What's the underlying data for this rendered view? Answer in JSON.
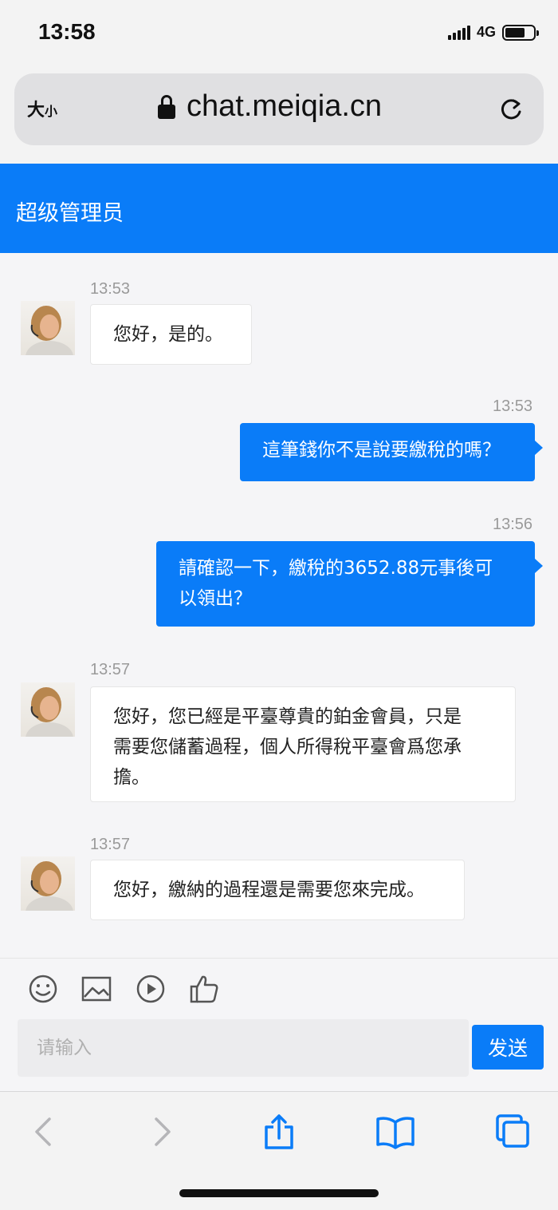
{
  "status_bar": {
    "time": "13:58",
    "network": "4G"
  },
  "browser": {
    "text_size_label": "大",
    "text_size_small": "小",
    "url": "chat.meiqia.cn",
    "icons": [
      "lock-icon",
      "reload-icon"
    ]
  },
  "chat": {
    "title": "超级管理员",
    "messages": [
      {
        "from": "agent",
        "time": "13:53",
        "text": "您好，是的。"
      },
      {
        "from": "user",
        "time": "13:53",
        "text": "這筆錢你不是說要繳稅的嗎？"
      },
      {
        "from": "user",
        "time": "13:56",
        "line1": "請確認一下，繳稅的3652.88元事後可",
        "line2": "以領出？"
      },
      {
        "from": "agent",
        "time": "13:57",
        "line1": "您好，您已經是平臺尊貴的鉑金會員，只是",
        "line2": "需要您儲蓄過程，個人所得稅平臺會爲您承",
        "line3": "擔。"
      },
      {
        "from": "agent",
        "time": "13:57",
        "text": "您好，繳納的過程還是需要您來完成。"
      }
    ]
  },
  "composer": {
    "tools": [
      "emoji-icon",
      "image-icon",
      "video-icon",
      "thumbs-up-icon"
    ],
    "placeholder": "请输入",
    "send_label": "发送"
  },
  "toolbar": {
    "icons": [
      "back-icon",
      "forward-icon",
      "share-icon",
      "bookmarks-icon",
      "tabs-icon"
    ]
  },
  "colors": {
    "accent": "#0a7cf8",
    "background": "#f5f5f7"
  }
}
